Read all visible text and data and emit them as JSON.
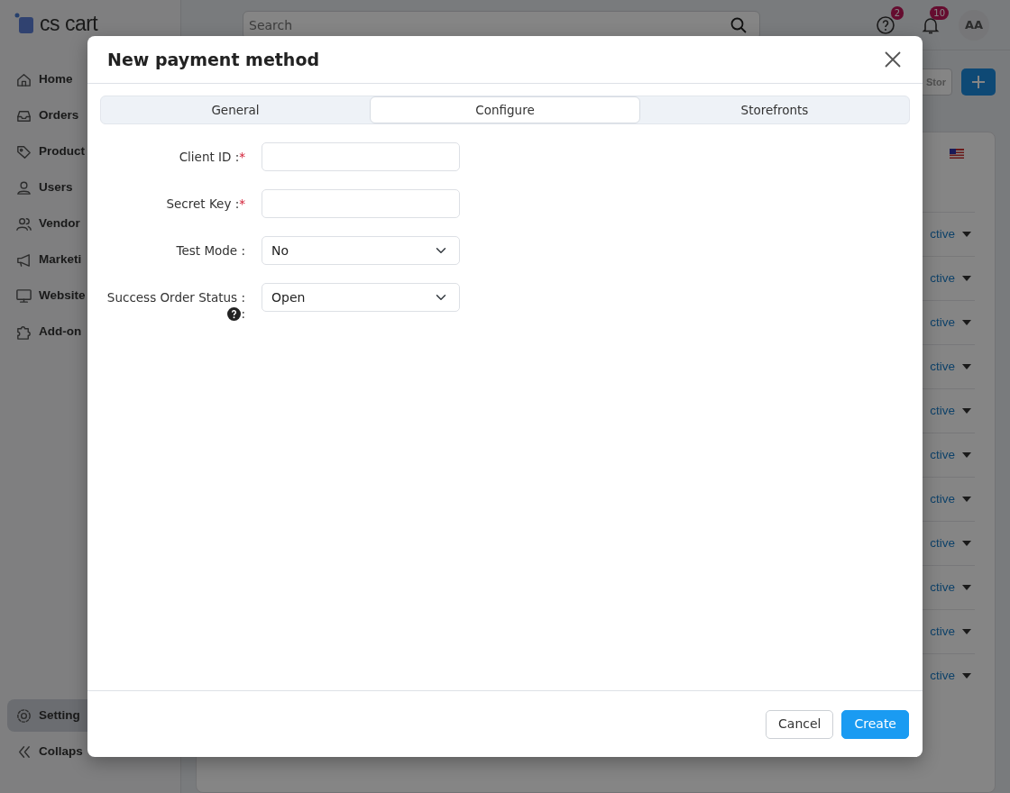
{
  "app": {
    "logo": "cs cart",
    "search": {
      "placeholder": "Search"
    },
    "help_badge": "2",
    "notifications_badge": "10",
    "avatar": "AA"
  },
  "sidebar": {
    "items": [
      {
        "label": "Home",
        "selected": false
      },
      {
        "label": "Orders",
        "selected": false
      },
      {
        "label": "Product",
        "selected": false
      },
      {
        "label": "Users",
        "selected": false
      },
      {
        "label": "Vendor",
        "selected": false
      },
      {
        "label": "Marketi",
        "selected": false
      },
      {
        "label": "Website",
        "selected": false
      },
      {
        "label": "Add-on",
        "selected": false
      }
    ],
    "bottom_items": [
      {
        "label": "Setting",
        "selected": true
      },
      {
        "label": "Collaps",
        "selected": false
      }
    ]
  },
  "toolbar": {
    "storefront_button": "Stor"
  },
  "content": {
    "rows": [
      {
        "status": "ctive"
      },
      {
        "status": "ctive"
      },
      {
        "status": "ctive"
      },
      {
        "status": "ctive"
      },
      {
        "status": "ctive"
      },
      {
        "status": "ctive"
      },
      {
        "status": "ctive"
      },
      {
        "status": "ctive"
      },
      {
        "status": "ctive"
      },
      {
        "status": "ctive"
      },
      {
        "status": "ctive"
      }
    ]
  },
  "modal": {
    "title": "New payment method",
    "tabs": [
      {
        "label": "General",
        "selected": false
      },
      {
        "label": "Configure",
        "selected": true
      },
      {
        "label": "Storefronts",
        "selected": false
      }
    ],
    "fields": [
      {
        "kind": "text",
        "label": "Client ID :",
        "required_mark": "*"
      },
      {
        "kind": "text",
        "label": "Secret Key :",
        "required_mark": "*"
      },
      {
        "kind": "select",
        "label": "Test Mode :",
        "value": "No"
      },
      {
        "kind": "select",
        "label": "Success Order Status :",
        "help_suffix": ":",
        "value": "Open"
      }
    ],
    "buttons": [
      {
        "label": "Cancel",
        "kind": "secondary"
      },
      {
        "label": "Create",
        "kind": "primary"
      }
    ]
  }
}
